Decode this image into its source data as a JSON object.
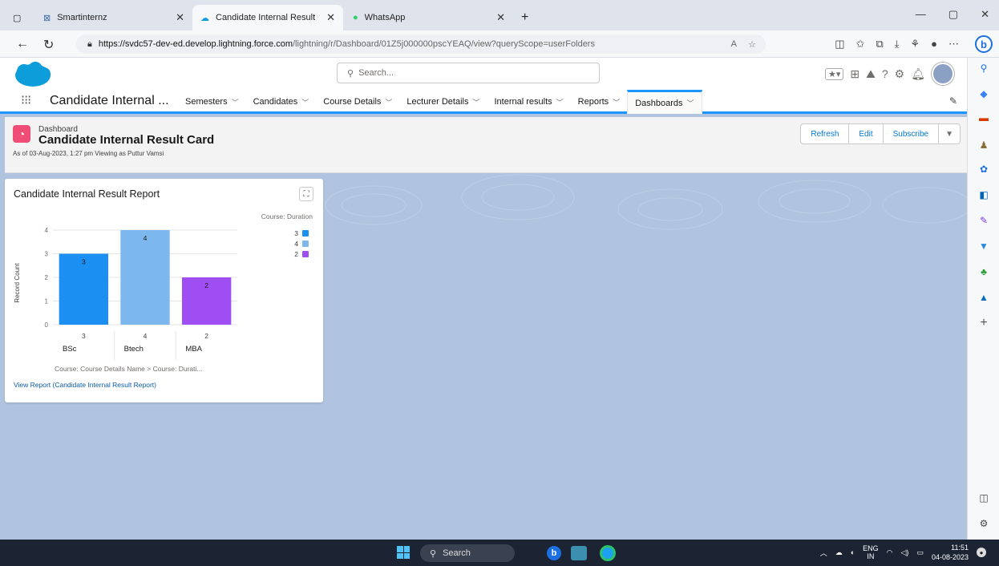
{
  "browser": {
    "tabs": [
      {
        "label": "Smartinternz"
      },
      {
        "label": "Candidate Internal Result Card | S"
      },
      {
        "label": "WhatsApp"
      }
    ],
    "url_domain": "https://svdc57-dev-ed.develop.lightning.force.com",
    "url_path": "/lightning/r/Dashboard/01Z5j000000pscYEAQ/view?queryScope=userFolders"
  },
  "header": {
    "search_placeholder": "Search..."
  },
  "app_nav": {
    "app_name": "Candidate Internal ...",
    "items": [
      {
        "label": "Semesters"
      },
      {
        "label": "Candidates"
      },
      {
        "label": "Course Details"
      },
      {
        "label": "Lecturer Details"
      },
      {
        "label": "Internal results"
      },
      {
        "label": "Reports"
      },
      {
        "label": "Dashboards"
      }
    ]
  },
  "dashboard": {
    "type_label": "Dashboard",
    "title": "Candidate Internal Result Card",
    "subtitle": "As of 03-Aug-2023, 1:27 pm Viewing as Puttur Vamsi",
    "buttons": {
      "refresh": "Refresh",
      "edit": "Edit",
      "subscribe": "Subscribe"
    }
  },
  "widget": {
    "title": "Candidate Internal Result Report",
    "view_report_link": "View Report (Candidate Internal Result Report)"
  },
  "chart_data": {
    "type": "bar",
    "title": "Candidate Internal Result Report",
    "categories": [
      "BSc",
      "Btech",
      "MBA"
    ],
    "category_totals": [
      "3",
      "4",
      "2"
    ],
    "values": [
      3,
      4,
      2
    ],
    "bar_labels": [
      "3",
      "4",
      "2"
    ],
    "bar_colors": [
      "#1b8ff2",
      "#7cb8ee",
      "#9e4ef2"
    ],
    "ylabel": "Record Count",
    "xlabel": "Course: Course Details Name  >  Course: Durati...",
    "ylim": [
      0,
      4
    ],
    "yticks": [
      0,
      1,
      2,
      3,
      4
    ],
    "legend": {
      "title": "Course: Duration",
      "placement": "top-right",
      "entries": [
        {
          "label": "3",
          "color": "#1b8ff2"
        },
        {
          "label": "4",
          "color": "#7cb8ee"
        },
        {
          "label": "2",
          "color": "#9e4ef2"
        }
      ]
    },
    "grid": true
  },
  "taskbar": {
    "search_label": "Search",
    "lang": "ENG",
    "region": "IN",
    "time": "11:51",
    "date": "04-08-2023"
  }
}
